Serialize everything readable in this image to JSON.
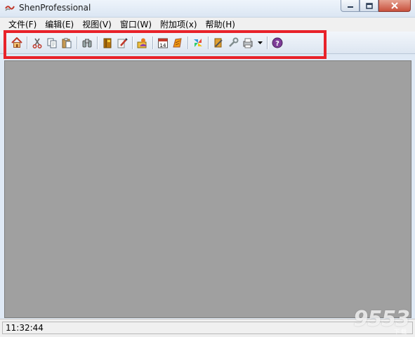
{
  "window": {
    "title": "ShenProfessional",
    "controls": [
      "minimize-icon",
      "maximize-icon",
      "close-icon"
    ]
  },
  "menubar": {
    "items": [
      {
        "label": "文件(F)"
      },
      {
        "label": "编辑(E)"
      },
      {
        "label": "视图(V)"
      },
      {
        "label": "窗口(W)"
      },
      {
        "label": "附加项(x)"
      },
      {
        "label": "帮助(H)"
      }
    ]
  },
  "toolbar": {
    "icons": [
      "home-icon",
      "cut-icon",
      "copy-icon",
      "paste-icon",
      "binoculars-icon",
      "book-icon",
      "edit-icon",
      "user-card-icon",
      "calendar-icon",
      "note-icon",
      "pinwheel-icon",
      "pencil-icon",
      "wrench-icon",
      "print-icon",
      "dropdown-icon",
      "help-icon"
    ],
    "calendar_day": "14",
    "help_glyph": "?",
    "highlight_color": "#e8222a"
  },
  "statusbar": {
    "time": "11:32:44"
  },
  "watermark": {
    "text": "9553",
    "subtext": "下载"
  },
  "colors": {
    "client_bg": "#a0a0a0",
    "titlebar_bg": "#dbe6f3",
    "close_button": "#c7503c"
  }
}
